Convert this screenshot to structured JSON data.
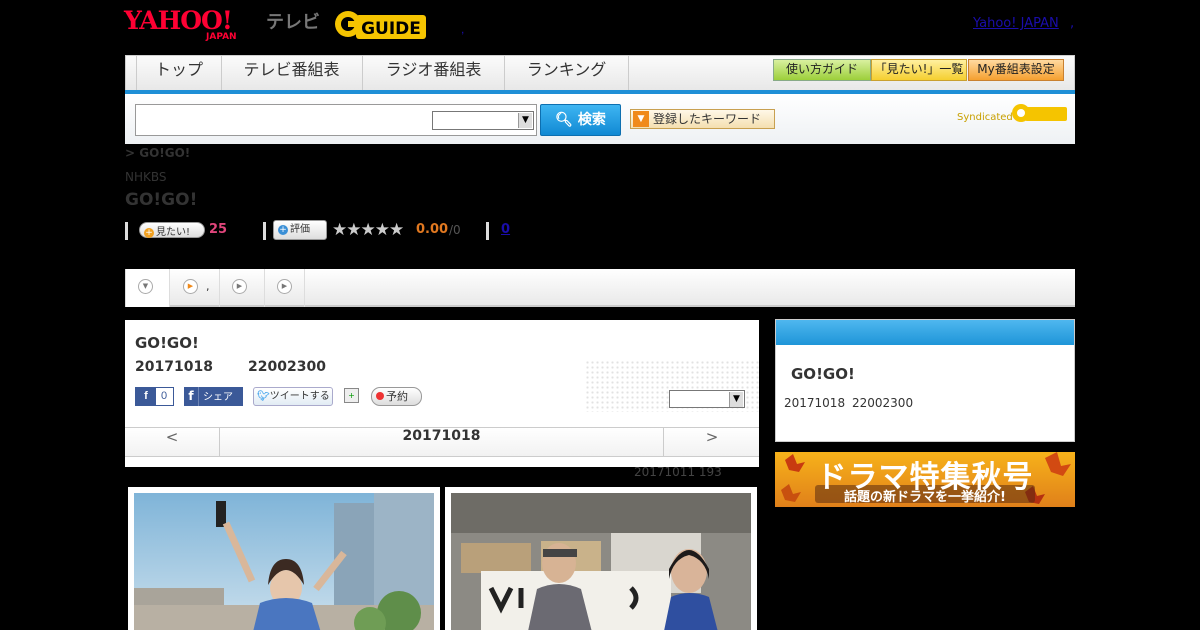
{
  "header": {
    "logo_yahoo": "YAHOO!",
    "logo_japan": "JAPAN",
    "logo_tv": "テレビ",
    "logo_gguide": "GUIDE",
    "dot": ",",
    "yahoo_japan_link": "Yahoo! JAPAN",
    "link_sep": ","
  },
  "nav": {
    "tabs": [
      "トップ",
      "テレビ番組表",
      "ラジオ番組表",
      "ランキング"
    ],
    "guide_buttons": [
      "使い方ガイド",
      "「見たい!」一覧",
      "My番組表設定"
    ]
  },
  "search": {
    "value": "",
    "select_value": "",
    "button_label": "検索",
    "keyword_button_label": "登録したキーワード",
    "syndicated_label": "Syndicated"
  },
  "program": {
    "breadcrumb": "> GO!GO!",
    "station": "NHKBS",
    "title": "GO!GO!",
    "want_label": "見たい!",
    "want_count": "25",
    "rate_label": "評価",
    "stars": "★★★★★",
    "rating_value": "0.00",
    "rating_den": "/0",
    "review_count": "0"
  },
  "tabs": {
    "second_tab_text": ","
  },
  "detail": {
    "title": "GO!GO!",
    "date": "20171018",
    "time": "22002300",
    "fb_like_count": "0",
    "fb_share_label": "シェア",
    "tweet_label": "ツイートする",
    "reserve_label": "予約",
    "select_value": "",
    "date_nav": {
      "prev": "<",
      "date": "20171018",
      "next": ">"
    },
    "previous_note": "20171011  193"
  },
  "side": {
    "title": "GO!GO!",
    "date": "20171018",
    "time": "22002300"
  },
  "banner": {
    "line1": "ドラマ特集秋号",
    "line2": "話題の新ドラマを一挙紹介!"
  },
  "colors": {
    "accent_blue": "#1e8fd6",
    "yahoo_red": "#ff0033",
    "want_pink": "#e0457b",
    "rating_orange": "#e07820"
  },
  "icons": [
    "search-icon",
    "play-circle-icon",
    "dropdown-circle-icon",
    "facebook-icon",
    "twitter-icon",
    "calendar-icon",
    "record-dot-icon"
  ]
}
